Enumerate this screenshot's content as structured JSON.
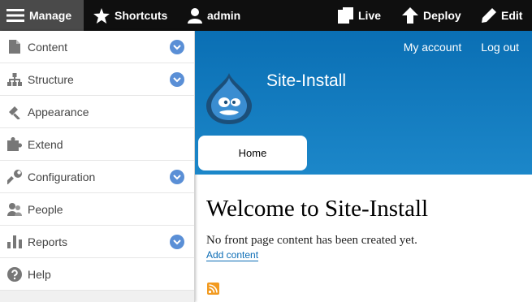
{
  "toolbar": {
    "manage": "Manage",
    "shortcuts": "Shortcuts",
    "user": "admin",
    "live": "Live",
    "deploy": "Deploy",
    "edit": "Edit"
  },
  "sidebar": {
    "items": [
      {
        "label": "Content",
        "icon": "file-icon",
        "expandable": true
      },
      {
        "label": "Structure",
        "icon": "sitemap-icon",
        "expandable": true
      },
      {
        "label": "Appearance",
        "icon": "paintbrush-icon",
        "expandable": false
      },
      {
        "label": "Extend",
        "icon": "puzzle-icon",
        "expandable": false
      },
      {
        "label": "Configuration",
        "icon": "wrench-icon",
        "expandable": true
      },
      {
        "label": "People",
        "icon": "people-icon",
        "expandable": false
      },
      {
        "label": "Reports",
        "icon": "bar-chart-icon",
        "expandable": true
      },
      {
        "label": "Help",
        "icon": "help-icon",
        "expandable": false
      }
    ]
  },
  "header": {
    "secondary_nav": [
      "My account",
      "Log out"
    ],
    "site_name": "Site-Install",
    "tabs": [
      "Home"
    ]
  },
  "main": {
    "title": "Welcome to Site-Install",
    "message": "No front page content has been created yet.",
    "add_link": "Add content"
  },
  "colors": {
    "toolbar_bg": "#0f0f0f",
    "manage_bg": "#4a4a4a",
    "header_blue": "#1c87c9",
    "chevron_blue": "#5a8fd6",
    "link_blue": "#0b6cb5",
    "rss_orange": "#f29a1f"
  }
}
